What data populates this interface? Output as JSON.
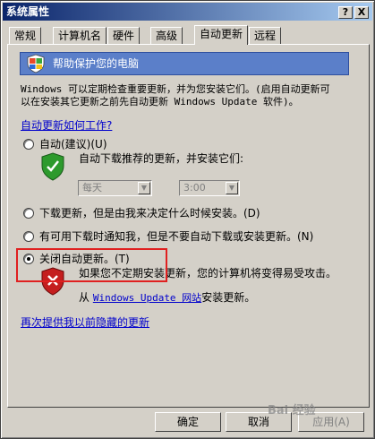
{
  "window": {
    "title": "系统属性",
    "help_btn": "?",
    "close_btn": "X"
  },
  "tabs": [
    "常规",
    "计算机名",
    "硬件",
    "高级",
    "自动更新",
    "远程"
  ],
  "active_tab": "自动更新",
  "header": {
    "title": "帮助保护您的电脑"
  },
  "description": {
    "line1": "Windows 可以定期检查重要更新，并为您安装它们。(启用自动更新可",
    "line2": "以在安装其它更新之前先自动更新 Windows Update 软件)。"
  },
  "how_link": "自动更新如何工作?",
  "options": {
    "auto": {
      "label": "自动(建议)(U)",
      "desc": "自动下载推荐的更新，并安装它们:",
      "day": "每天",
      "time": "3:00"
    },
    "download": {
      "label": "下载更新，但是由我来决定什么时候安装。(D)"
    },
    "notify": {
      "label": "有可用下载时通知我，但是不要自动下载或安装更新。(N)"
    },
    "off": {
      "label": "关闭自动更新。(T)",
      "desc": "如果您不定期安装更新，您的计算机将变得易受攻击。"
    }
  },
  "site_line": {
    "prefix": "从",
    "link": "Windows Update 网站",
    "suffix": "安装更新。"
  },
  "hidden_link": "再次提供我以前隐藏的更新",
  "buttons": {
    "ok": "确定",
    "cancel": "取消",
    "apply": "应用(A)"
  },
  "watermark": "Bai 经验",
  "colors": {
    "title_bar": "#0a246a",
    "header_bg": "#5b7fc9",
    "link": "#0000cc",
    "highlight_box": "#e02020"
  },
  "icons": [
    "windows-shield-icon",
    "green-shield-icon",
    "red-shield-icon"
  ]
}
